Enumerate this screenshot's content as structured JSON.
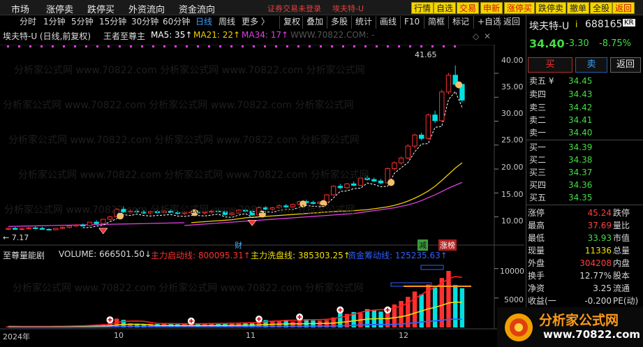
{
  "menu": {
    "market": "市场",
    "limit_up": "涨停卖",
    "limit_down": "跌停买",
    "foreign": "外资流向",
    "capital": "资金流向"
  },
  "status": {
    "trade": "证券交易未登录",
    "current": "埃夫特-U"
  },
  "toolbar": [
    "行情",
    "自选",
    "交易",
    "申新",
    "涨停买",
    "跌停卖",
    "撤单",
    "全股",
    "返回"
  ],
  "chart_header": {
    "stock": "埃夫特-U (日线,前复权)",
    "indicator": "王者至尊主",
    "ma5": "MA5: 35↑",
    "ma21": "MA21: 22↑",
    "ma34": "MA34: 17↑",
    "watermark_url": "WWW.70822.COM: -"
  },
  "chart_tabs_top": [
    "复权",
    "叠加",
    "多股",
    "统计",
    "画线",
    "F10",
    "简框",
    "标记",
    "+自选",
    "返回"
  ],
  "periods": [
    "分时",
    "1分钟",
    "5分钟",
    "15分钟",
    "30分钟",
    "60分钟",
    "日线",
    "周线",
    "更多 〉"
  ],
  "active_period": "日线",
  "watermark_text": "分析家公式网 www.70822.com 分析家公式网 www.70822.com 分析家公式网",
  "price_axis": [
    "40.00",
    "35.00",
    "30.00",
    "25.00",
    "20.00",
    "15.00",
    "10.00"
  ],
  "annotations": {
    "high": "41.65",
    "low": "← 7.17",
    "cai": "财",
    "jian": "减",
    "zhangbang": "涨榜"
  },
  "volume_header": {
    "name": "至尊量能剧",
    "volume": "VOLUME: 666501.50↓",
    "main_start": "主力启动线: 800095.31↑",
    "main_wash": "主力洗盘线: 385303.25↑",
    "gold": "资金筹动线: 125235.63↑"
  },
  "volume_axis": [
    "10000",
    "5000"
  ],
  "date_axis": [
    "2024年",
    "10",
    "11",
    "12"
  ],
  "quote": {
    "name": "埃夫特-U",
    "flags": "i",
    "code": "688165",
    "badge": "KR",
    "price": "34.40",
    "change": "-3.30",
    "change_pct": "-8.75%",
    "buy": "买",
    "sell": "卖",
    "back": "返回"
  },
  "asks": [
    {
      "label": "卖五 ¥",
      "price": "34.45",
      "vol": ""
    },
    {
      "label": "卖四",
      "price": "34.43",
      "vol": ""
    },
    {
      "label": "卖三",
      "price": "34.42",
      "vol": ""
    },
    {
      "label": "卖二",
      "price": "34.41",
      "vol": ""
    },
    {
      "label": "卖一",
      "price": "34.40",
      "vol": ""
    }
  ],
  "bids": [
    {
      "label": "买一",
      "price": "34.39",
      "vol": ""
    },
    {
      "label": "买二",
      "price": "34.38",
      "vol": ""
    },
    {
      "label": "买三",
      "price": "34.37",
      "vol": ""
    },
    {
      "label": "买四",
      "price": "34.36",
      "vol": ""
    },
    {
      "label": "买五",
      "price": "34.35",
      "vol": ""
    }
  ],
  "info": [
    {
      "a": "涨停",
      "b": "45.24",
      "bc": "#ff4040",
      "c": "跌停"
    },
    {
      "a": "最高",
      "b": "37.69",
      "bc": "#ff4040",
      "c": "量比"
    },
    {
      "a": "最低",
      "b": "33.93",
      "bc": "#44dd44",
      "c": "市值"
    },
    {
      "a": "现量",
      "b": "11336",
      "bc": "#f0e000",
      "c": "总量"
    },
    {
      "a": "外盘",
      "b": "304208",
      "bc": "#ff4040",
      "c": "内盘"
    },
    {
      "a": "换手",
      "b": "12.77%",
      "bc": "#d8d8d8",
      "c": "股本"
    },
    {
      "a": "净资",
      "b": "3.25",
      "bc": "#d8d8d8",
      "c": "流通"
    },
    {
      "a": "收益(一",
      "b": "-0.200",
      "bc": "#d8d8d8",
      "c": "PE(动)"
    }
  ],
  "logo": {
    "text": "分析家公式网",
    "url": "www.70822.com"
  },
  "colors": {
    "up": "#ff3030",
    "down": "#00e0e0",
    "ma5": "#ffffff",
    "ma21": "#f0d000",
    "ma34": "#e040e0",
    "tip": "#f0c070"
  },
  "chart_data": {
    "type": "candlestick",
    "price_ticks": [
      40,
      35,
      30,
      25,
      20,
      15,
      10
    ],
    "ylim": [
      4.4,
      45.4
    ],
    "candles": [
      [
        0,
        7.4,
        7.8,
        7.2,
        7.6
      ],
      [
        1,
        7.6,
        7.9,
        7.3,
        7.4
      ],
      [
        2,
        7.4,
        7.7,
        7.2,
        7.5
      ],
      [
        3,
        7.5,
        7.9,
        7.3,
        7.7
      ],
      [
        4,
        7.7,
        8.0,
        7.4,
        7.6
      ],
      [
        5,
        7.6,
        7.9,
        7.3,
        7.4
      ],
      [
        6,
        7.4,
        7.6,
        7.17,
        7.3
      ],
      [
        7,
        7.3,
        7.7,
        7.2,
        7.6
      ],
      [
        8,
        7.6,
        8.0,
        7.4,
        7.8
      ],
      [
        9,
        7.8,
        8.2,
        7.6,
        8.1
      ],
      [
        10,
        8.1,
        8.5,
        7.9,
        8.3
      ],
      [
        11,
        8.3,
        8.6,
        8.0,
        8.1
      ],
      [
        12,
        8.2,
        9.0,
        8.0,
        8.9
      ],
      [
        13,
        8.9,
        9.3,
        8.3,
        8.6
      ],
      [
        14,
        8.6,
        9.6,
        8.5,
        9.5
      ],
      [
        15,
        9.5,
        10.2,
        9.3,
        10.0
      ],
      [
        16,
        10.0,
        11.8,
        9.9,
        11.6
      ],
      [
        17,
        11.6,
        12.2,
        10.8,
        11.0
      ],
      [
        18,
        11.0,
        11.6,
        10.6,
        11.2
      ],
      [
        19,
        11.2,
        11.7,
        10.9,
        11.0
      ],
      [
        20,
        11.0,
        11.4,
        10.6,
        10.8
      ],
      [
        21,
        10.8,
        11.3,
        10.5,
        11.1
      ],
      [
        22,
        11.1,
        11.5,
        10.6,
        10.9
      ],
      [
        23,
        10.9,
        11.4,
        10.7,
        11.2
      ],
      [
        24,
        11.2,
        11.6,
        10.8,
        10.9
      ],
      [
        25,
        10.9,
        11.3,
        10.5,
        10.7
      ],
      [
        26,
        10.7,
        11.2,
        10.4,
        10.9
      ],
      [
        27,
        10.9,
        11.4,
        10.6,
        11.0
      ],
      [
        28,
        11.0,
        11.3,
        10.6,
        10.8
      ],
      [
        29,
        10.8,
        11.2,
        10.5,
        11.0
      ],
      [
        30,
        11.0,
        11.5,
        10.7,
        11.2
      ],
      [
        31,
        11.2,
        11.6,
        10.9,
        11.1
      ],
      [
        32,
        11.1,
        11.4,
        10.3,
        10.5
      ],
      [
        33,
        10.5,
        11.0,
        10.2,
        10.8
      ],
      [
        34,
        10.8,
        11.6,
        10.7,
        11.4
      ],
      [
        35,
        11.4,
        11.8,
        11.0,
        11.2
      ],
      [
        36,
        11.2,
        11.4,
        10.2,
        10.4
      ],
      [
        37,
        10.4,
        12.2,
        10.3,
        11.9
      ],
      [
        38,
        11.9,
        12.3,
        11.4,
        11.6
      ],
      [
        39,
        11.6,
        12.1,
        11.3,
        11.9
      ],
      [
        40,
        11.9,
        12.6,
        11.7,
        12.3
      ],
      [
        41,
        12.3,
        12.7,
        11.9,
        12.1
      ],
      [
        42,
        12.1,
        12.8,
        11.9,
        12.6
      ],
      [
        43,
        12.6,
        13.4,
        12.4,
        13.2
      ],
      [
        44,
        13.2,
        13.6,
        12.8,
        13.0
      ],
      [
        45,
        13.0,
        13.4,
        12.6,
        12.8
      ],
      [
        46,
        12.8,
        13.3,
        12.5,
        13.1
      ],
      [
        47,
        13.1,
        14.8,
        13.0,
        14.6
      ],
      [
        48,
        14.6,
        16.6,
        14.4,
        16.4
      ],
      [
        49,
        16.4,
        16.9,
        15.8,
        16.1
      ],
      [
        50,
        16.1,
        17.1,
        15.9,
        16.9
      ],
      [
        51,
        16.9,
        17.4,
        16.4,
        16.6
      ],
      [
        52,
        16.6,
        18.3,
        16.5,
        18.1
      ],
      [
        53,
        18.1,
        18.6,
        17.6,
        17.8
      ],
      [
        54,
        17.8,
        18.2,
        17.3,
        17.5
      ],
      [
        55,
        17.5,
        17.9,
        16.8,
        17.1
      ],
      [
        56,
        17.1,
        20.3,
        16.9,
        20.1
      ],
      [
        57,
        20.1,
        21.6,
        19.7,
        21.3
      ],
      [
        58,
        21.3,
        22.6,
        20.9,
        22.3
      ],
      [
        59,
        22.3,
        25.2,
        22.0,
        24.8
      ],
      [
        60,
        24.8,
        27.4,
        24.3,
        27.1
      ],
      [
        61,
        27.1,
        27.6,
        26.0,
        26.4
      ],
      [
        62,
        26.4,
        31.6,
        26.1,
        31.3
      ],
      [
        63,
        31.3,
        32.2,
        29.6,
        30.1
      ],
      [
        64,
        30.1,
        36.6,
        29.8,
        36.1
      ],
      [
        65,
        36.1,
        40.1,
        35.6,
        39.6
      ],
      [
        66,
        39.6,
        41.65,
        37.3,
        37.7
      ],
      [
        67,
        37.7,
        37.7,
        33.93,
        34.4
      ]
    ],
    "ma21": [
      8.8,
      8.9,
      9.0,
      9.1,
      9.2,
      9.3,
      9.4,
      9.6,
      9.8,
      9.9,
      10.0,
      10.1,
      10.2,
      10.3,
      10.4,
      10.5,
      10.6,
      10.7,
      10.8,
      10.9,
      11.0,
      11.1,
      11.2,
      11.2,
      11.3,
      11.4,
      11.5,
      11.7,
      11.9,
      12.1,
      12.4,
      12.8,
      13.3,
      13.9,
      14.6,
      15.4,
      16.4,
      17.6,
      18.9,
      20.2,
      21.3
    ],
    "ma34": [
      8.2,
      8.3,
      8.4,
      8.5,
      8.6,
      8.7,
      8.8,
      8.9,
      9.0,
      9.1,
      9.2,
      9.3,
      9.4,
      9.5,
      9.6,
      9.7,
      9.8,
      9.9,
      10.0,
      10.1,
      10.2,
      10.3,
      10.4,
      10.5,
      10.6,
      10.7,
      10.9,
      11.1,
      11.3,
      11.5,
      11.7,
      11.9,
      12.2,
      12.5,
      12.9,
      13.4,
      14.0,
      14.6,
      15.3,
      16.0,
      16.6,
      17.2
    ],
    "volumes": [
      180,
      150,
      140,
      170,
      160,
      150,
      190,
      170,
      210,
      250,
      320,
      300,
      420,
      480,
      560,
      820,
      1500,
      1300,
      700,
      650,
      600,
      620,
      580,
      610,
      590,
      560,
      600,
      620,
      580,
      600,
      650,
      620,
      700,
      680,
      720,
      800,
      760,
      950,
      1250,
      1100,
      1050,
      1150,
      1000,
      1300,
      1400,
      1200,
      1150,
      1250,
      1700,
      2500,
      2300,
      2600,
      2450,
      3100,
      2900,
      2700,
      2500,
      3900,
      4500,
      5200,
      6100,
      5600,
      7300,
      6800,
      8400,
      9600,
      7200,
      6666.5
    ],
    "volume_ticks": [
      10000,
      5000
    ],
    "dates": [
      "2024年",
      "10",
      "11",
      "12"
    ]
  }
}
